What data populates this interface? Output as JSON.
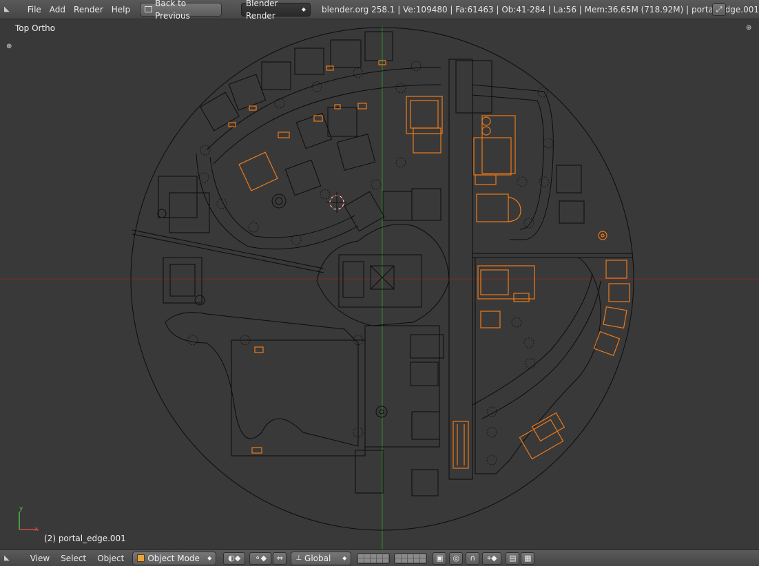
{
  "topbar": {
    "menus": [
      "File",
      "Add",
      "Render",
      "Help"
    ],
    "back_button": "Back to Previous",
    "render_engine": "Blender Render",
    "stats": "blender.org 258.1 | Ve:109480 | Fa:61463 | Ob:41-284 | La:56 | Mem:36.65M (718.92M) | portal_edge.001"
  },
  "viewport": {
    "view_label": "Top Ortho",
    "object_label": "(2) portal_edge.001",
    "axis_x": "x",
    "axis_y": "y"
  },
  "bottombar": {
    "menus": [
      "View",
      "Select",
      "Object"
    ],
    "mode": "Object Mode",
    "orientation": "Global"
  },
  "colors": {
    "wire": "#0a0a0a",
    "selected": "#f07a18",
    "grid_x_axis": "#8a2a2a",
    "grid_y_axis": "#2e8a2e"
  }
}
